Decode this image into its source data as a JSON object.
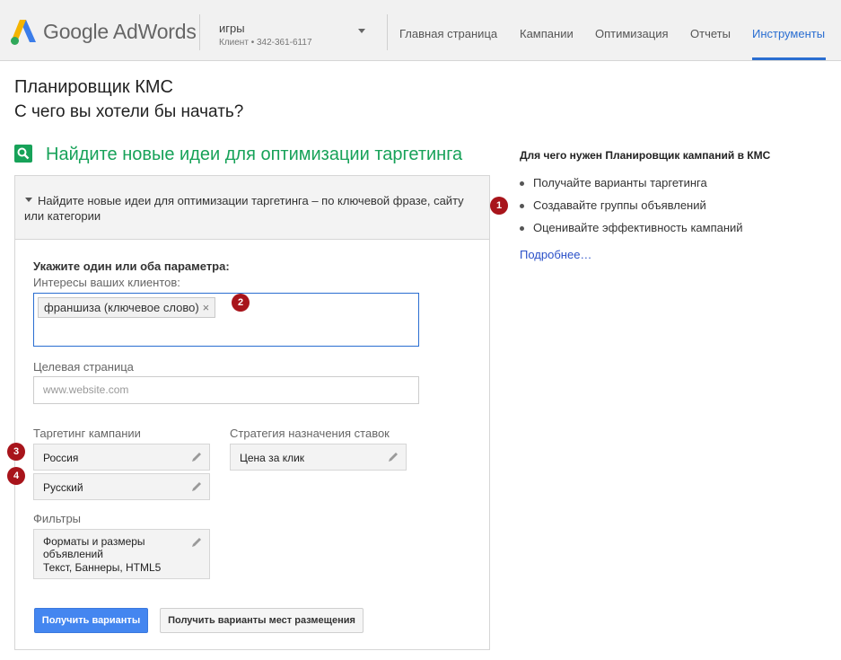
{
  "header": {
    "logo_text": "Google AdWords",
    "account_name": "игры",
    "account_meta": "Клиент  •  342-361-6117",
    "nav": [
      {
        "label": "Главная страница",
        "active": false
      },
      {
        "label": "Кампании",
        "active": false
      },
      {
        "label": "Оптимизация",
        "active": false
      },
      {
        "label": "Отчеты",
        "active": false
      },
      {
        "label": "Инструменты",
        "active": true
      }
    ],
    "colors": {
      "active_nav": "#2a6ed1",
      "logo_blue": "#3b7de9",
      "logo_green": "#2fa85a",
      "logo_yellow": "#f4b400"
    }
  },
  "page": {
    "title": "Планировщик КМС",
    "subtitle": "С чего вы хотели бы начать?"
  },
  "section": {
    "icon": "search-icon",
    "heading": "Найдите новые идеи для оптимизации таргетинга",
    "accent": "#17a259",
    "panel_header": "Найдите новые идеи для оптимизации таргетинга – по ключевой фразе, сайту или категории"
  },
  "form": {
    "instruction": "Укажите один или оба параметра:",
    "interests_label": "Интересы ваших клиентов:",
    "keyword_chip": "франшиза (ключевое слово)",
    "chip_remove": "×",
    "landing_label": "Целевая страница",
    "landing_placeholder": "www.website.com",
    "targeting_label": "Таргетинг кампании",
    "location_value": "Россия",
    "language_value": "Русский",
    "bidding_label": "Стратегия назначения ставок",
    "bidding_value": "Цена за клик",
    "filters_label": "Фильтры",
    "filter_title": "Форматы и размеры объявлений",
    "filter_value": "Текст, Баннеры, HTML5",
    "primary_button": "Получить варианты",
    "secondary_button": "Получить варианты мест размещения"
  },
  "badges": [
    "1",
    "2",
    "3",
    "4"
  ],
  "sidebar": {
    "title": "Для чего нужен Планировщик кампаний в КМС",
    "items": [
      "Получайте варианты таргетинга",
      "Создавайте группы объявлений",
      "Оценивайте эффективность кампаний"
    ],
    "link": "Подробнее…"
  }
}
